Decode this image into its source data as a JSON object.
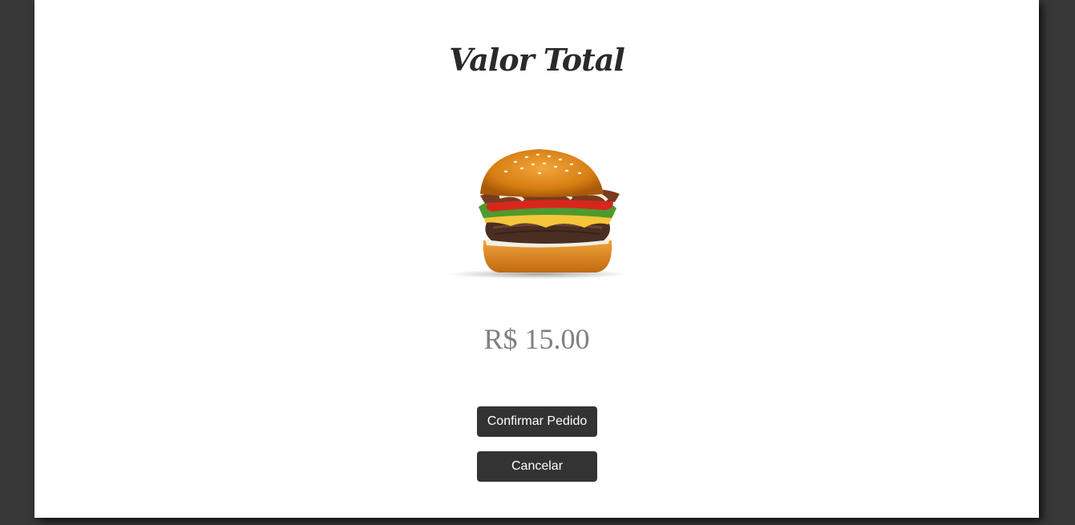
{
  "page": {
    "title": "Valor Total",
    "price": "R$ 15.00",
    "product_image": "hamburger",
    "colors": {
      "background": "#383838",
      "card": "#ffffff",
      "title": "#2a2a2a",
      "price": "#808080",
      "button": "#333333",
      "button_text": "#ffffff"
    }
  },
  "actions": {
    "confirm_label": "Confirmar Pedido",
    "cancel_label": "Cancelar"
  }
}
